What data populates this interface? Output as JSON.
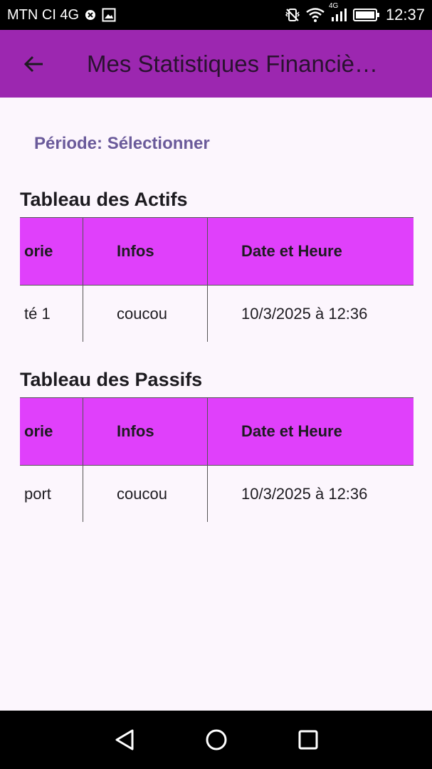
{
  "status_bar": {
    "carrier": "MTN CI 4G",
    "network_type": "4G",
    "time": "12:37"
  },
  "app_bar": {
    "title": "Mes Statistiques Financiè…",
    "background_color": "#9c27b0"
  },
  "filter": {
    "period_label": "Période: Sélectionner"
  },
  "assets": {
    "title": "Tableau des Actifs",
    "columns": [
      "orie",
      "Infos",
      "Date et Heure"
    ],
    "rows": [
      [
        "té 1",
        "coucou",
        "10/3/2025 à 12:36"
      ]
    ]
  },
  "liabilities": {
    "title": "Tableau des Passifs",
    "columns": [
      "orie",
      "Infos",
      "Date et Heure"
    ],
    "rows": [
      [
        "port",
        "coucou",
        "10/3/2025 à 12:36"
      ]
    ]
  },
  "colors": {
    "header_cell": "#e040fb",
    "page_background": "#fcf6fd",
    "period_text": "#6a5a9a"
  }
}
